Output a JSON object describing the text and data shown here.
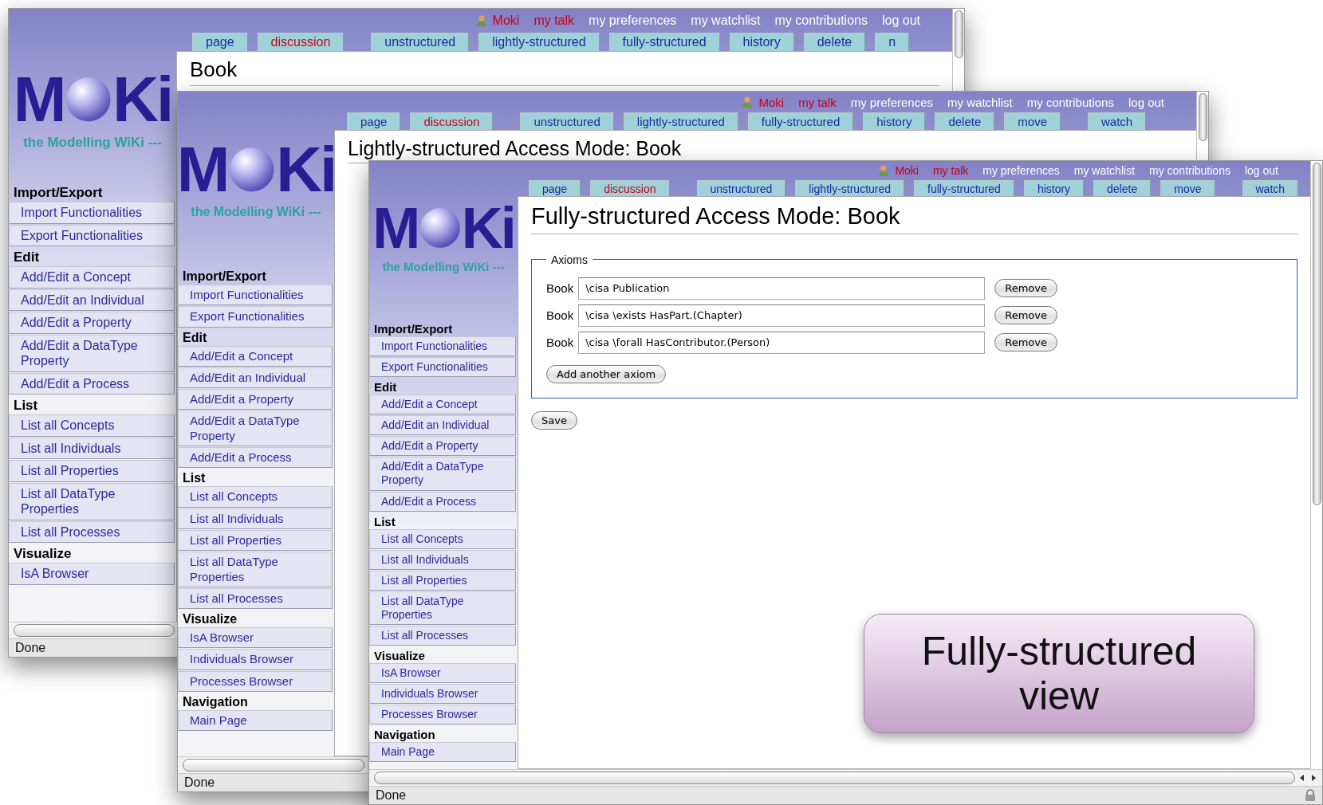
{
  "windows": [
    {
      "user_links": [
        {
          "label": "Moki",
          "missing": true
        },
        {
          "label": "my talk",
          "missing": true
        },
        {
          "label": "my preferences",
          "missing": false
        },
        {
          "label": "my watchlist",
          "missing": false
        },
        {
          "label": "my contributions",
          "missing": false
        },
        {
          "label": "log out",
          "missing": false
        }
      ],
      "tab_groups": [
        {
          "tabs": [
            {
              "label": "page",
              "missing": false
            },
            {
              "label": "discussion",
              "missing": true
            }
          ]
        },
        {
          "tabs": [
            {
              "label": "unstructured",
              "missing": false
            },
            {
              "label": "lightly-structured",
              "missing": false
            },
            {
              "label": "fully-structured",
              "missing": false
            },
            {
              "label": "history",
              "missing": false
            },
            {
              "label": "delete",
              "missing": false
            },
            {
              "label": "n",
              "missing": false
            }
          ]
        }
      ],
      "logo": {
        "left": "M",
        "right": "Ki",
        "tagline": "the Modelling WiKi ---"
      },
      "title": "Book",
      "sidebar": [
        {
          "heading": "Import/Export",
          "items": [
            "Import Functionalities",
            "Export Functionalities"
          ]
        },
        {
          "heading": "Edit",
          "items": [
            "Add/Edit a Concept",
            "Add/Edit an Individual",
            "Add/Edit a Property",
            "Add/Edit a DataType Property",
            "Add/Edit a Process"
          ]
        },
        {
          "heading": "List",
          "items": [
            "List all Concepts",
            "List all Individuals",
            "List all Properties",
            "List all DataType Properties",
            "List all Processes"
          ]
        },
        {
          "heading": "Visualize",
          "items": [
            "IsA Browser"
          ]
        }
      ],
      "status": "Done"
    },
    {
      "user_links": [
        {
          "label": "Moki",
          "missing": true
        },
        {
          "label": "my talk",
          "missing": true
        },
        {
          "label": "my preferences",
          "missing": false
        },
        {
          "label": "my watchlist",
          "missing": false
        },
        {
          "label": "my contributions",
          "missing": false
        },
        {
          "label": "log out",
          "missing": false
        }
      ],
      "tab_groups": [
        {
          "tabs": [
            {
              "label": "page",
              "missing": false
            },
            {
              "label": "discussion",
              "missing": true
            }
          ]
        },
        {
          "tabs": [
            {
              "label": "unstructured",
              "missing": false
            },
            {
              "label": "lightly-structured",
              "missing": false
            },
            {
              "label": "fully-structured",
              "missing": false
            },
            {
              "label": "history",
              "missing": false
            },
            {
              "label": "delete",
              "missing": false
            },
            {
              "label": "move",
              "missing": false
            }
          ]
        },
        {
          "tabs": [
            {
              "label": "watch",
              "missing": false
            }
          ]
        }
      ],
      "logo": {
        "left": "M",
        "right": "Ki",
        "tagline": "the Modelling WiKi ---"
      },
      "title": "Lightly-structured Access Mode: Book",
      "sidebar": [
        {
          "heading": "Import/Export",
          "items": [
            "Import Functionalities",
            "Export Functionalities"
          ]
        },
        {
          "heading": "Edit",
          "items": [
            "Add/Edit a Concept",
            "Add/Edit an Individual",
            "Add/Edit a Property",
            "Add/Edit a DataType Property",
            "Add/Edit a Process"
          ]
        },
        {
          "heading": "List",
          "items": [
            "List all Concepts",
            "List all Individuals",
            "List all Properties",
            "List all DataType Properties",
            "List all Processes"
          ]
        },
        {
          "heading": "Visualize",
          "items": [
            "IsA Browser",
            "Individuals Browser",
            "Processes Browser"
          ]
        },
        {
          "heading": "Navigation",
          "items": [
            "Main Page"
          ]
        }
      ],
      "status": "Done"
    },
    {
      "user_links": [
        {
          "label": "Moki",
          "missing": true
        },
        {
          "label": "my talk",
          "missing": true
        },
        {
          "label": "my preferences",
          "missing": false
        },
        {
          "label": "my watchlist",
          "missing": false
        },
        {
          "label": "my contributions",
          "missing": false
        },
        {
          "label": "log out",
          "missing": false
        }
      ],
      "tab_groups": [
        {
          "tabs": [
            {
              "label": "page",
              "missing": false
            },
            {
              "label": "discussion",
              "missing": true
            }
          ]
        },
        {
          "tabs": [
            {
              "label": "unstructured",
              "missing": false
            },
            {
              "label": "lightly-structured",
              "missing": false
            },
            {
              "label": "fully-structured",
              "missing": false
            },
            {
              "label": "history",
              "missing": false
            },
            {
              "label": "delete",
              "missing": false
            },
            {
              "label": "move",
              "missing": false
            }
          ]
        },
        {
          "tabs": [
            {
              "label": "watch",
              "missing": false
            }
          ]
        }
      ],
      "logo": {
        "left": "M",
        "right": "Ki",
        "tagline": "the Modelling WiKi ---"
      },
      "title": "Fully-structured Access Mode: Book",
      "form": {
        "legend": "Axioms",
        "axioms": [
          {
            "label": "Book",
            "value": "\\cisa Publication",
            "button": "Remove"
          },
          {
            "label": "Book",
            "value": "\\cisa \\exists HasPart.(Chapter)",
            "button": "Remove"
          },
          {
            "label": "Book",
            "value": "\\cisa \\forall HasContributor.(Person)",
            "button": "Remove"
          }
        ],
        "add_button": "Add another axiom",
        "save_button": "Save"
      },
      "sidebar": [
        {
          "heading": "Import/Export",
          "items": [
            "Import Functionalities",
            "Export Functionalities"
          ]
        },
        {
          "heading": "Edit",
          "items": [
            "Add/Edit a Concept",
            "Add/Edit an Individual",
            "Add/Edit a Property",
            "Add/Edit a DataType Property",
            "Add/Edit a Process"
          ]
        },
        {
          "heading": "List",
          "items": [
            "List all Concepts",
            "List all Individuals",
            "List all Properties",
            "List all DataType Properties",
            "List all Processes"
          ]
        },
        {
          "heading": "Visualize",
          "items": [
            "IsA Browser",
            "Individuals Browser",
            "Processes Browser"
          ]
        },
        {
          "heading": "Navigation",
          "items": [
            "Main Page"
          ]
        }
      ],
      "status": "Done"
    }
  ],
  "callout": "Fully-structured view"
}
